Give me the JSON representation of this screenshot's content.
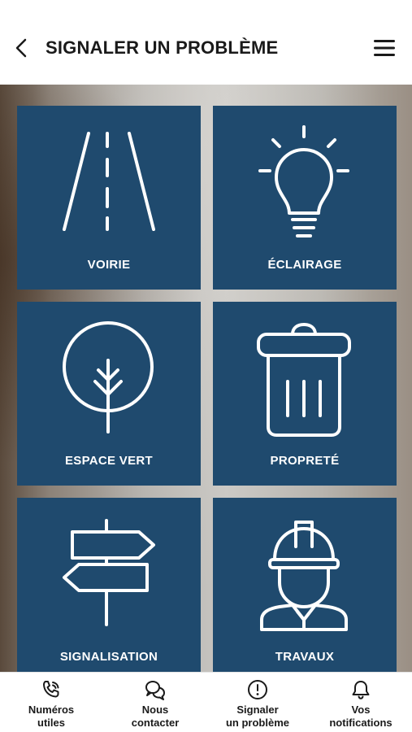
{
  "header": {
    "title": "SIGNALER UN PROBLÈME",
    "back_icon": "chevron-left-icon",
    "menu_icon": "hamburger-menu-icon"
  },
  "tiles": [
    {
      "label": "VOIRIE",
      "icon": "road-icon"
    },
    {
      "label": "ÉCLAIRAGE",
      "icon": "lightbulb-icon"
    },
    {
      "label": "ESPACE VERT",
      "icon": "tree-icon"
    },
    {
      "label": "PROPRETÉ",
      "icon": "trash-can-icon"
    },
    {
      "label": "SIGNALISATION",
      "icon": "signpost-icon"
    },
    {
      "label": "TRAVAUX",
      "icon": "construction-worker-icon"
    }
  ],
  "bottom_nav": [
    {
      "label": "Numéros\nutiles",
      "icon": "phone-icon"
    },
    {
      "label": "Nous\ncontacter",
      "icon": "chat-bubbles-icon"
    },
    {
      "label": "Signaler\nun problème",
      "icon": "alert-circle-icon"
    },
    {
      "label": "Vos\nnotifications",
      "icon": "bell-icon"
    }
  ],
  "colors": {
    "tile_background": "#1f4a6e",
    "tile_foreground": "#ffffff",
    "header_background": "#ffffff",
    "text": "#1a1a1a"
  }
}
